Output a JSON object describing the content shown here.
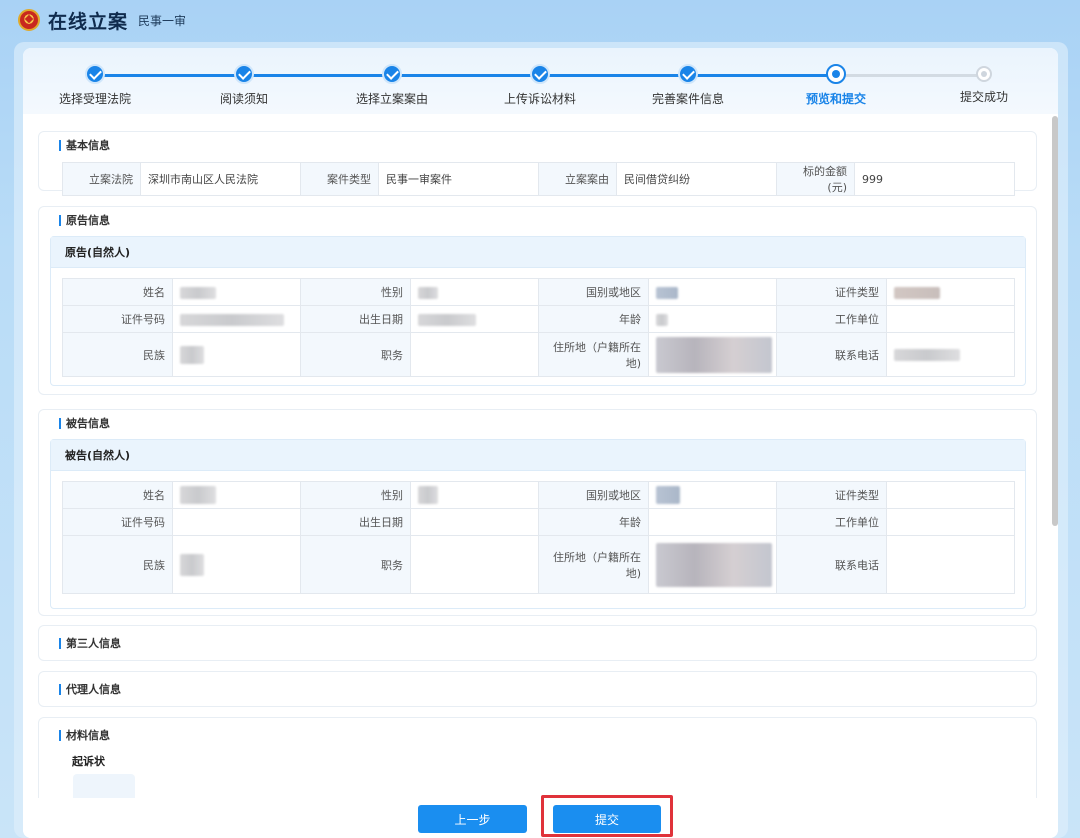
{
  "app": {
    "title": "在线立案",
    "subtitle": "民事一审"
  },
  "steps": [
    {
      "label": "选择受理法院",
      "state": "done"
    },
    {
      "label": "阅读须知",
      "state": "done"
    },
    {
      "label": "选择立案案由",
      "state": "done"
    },
    {
      "label": "上传诉讼材料",
      "state": "done"
    },
    {
      "label": "完善案件信息",
      "state": "done"
    },
    {
      "label": "预览和提交",
      "state": "current"
    },
    {
      "label": "提交成功",
      "state": "todo"
    }
  ],
  "basic": {
    "title": "基本信息",
    "court_label": "立案法院",
    "court_value": "深圳市南山区人民法院",
    "type_label": "案件类型",
    "type_value": "民事一审案件",
    "cause_label": "立案案由",
    "cause_value": "民间借贷纠纷",
    "amount_label": "标的金额(元)",
    "amount_value": "999"
  },
  "plaintiff": {
    "title": "原告信息",
    "party_title": "原告(自然人)"
  },
  "defendant": {
    "title": "被告信息",
    "party_title": "被告(自然人)"
  },
  "person_labels": {
    "name": "姓名",
    "gender": "性别",
    "country": "国别或地区",
    "id_type": "证件类型",
    "id_number": "证件号码",
    "birth": "出生日期",
    "age": "年龄",
    "employer": "工作单位",
    "ethnicity": "民族",
    "position": "职务",
    "address_line1": "住所地（户籍所在",
    "address_line2": "地)",
    "phone": "联系电话"
  },
  "third_party": {
    "title": "第三人信息"
  },
  "agent": {
    "title": "代理人信息"
  },
  "materials": {
    "title": "材料信息",
    "item": "起诉状"
  },
  "buttons": {
    "prev": "上一步",
    "submit": "提交"
  },
  "colors": {
    "accent": "#1a84e8",
    "highlight": "#e0323a"
  }
}
